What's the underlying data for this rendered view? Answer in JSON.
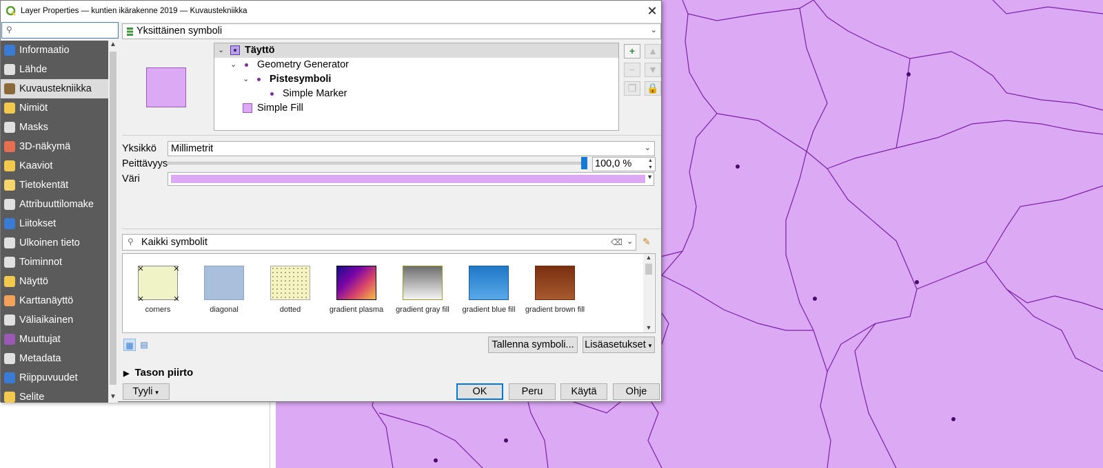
{
  "window": {
    "title": "Layer Properties — kuntien ikärakenne 2019 — Kuvaustekniikka",
    "close_glyph": "✕"
  },
  "sidebar": {
    "search_placeholder": "",
    "items": [
      {
        "label": "Informaatio",
        "icon": "info-icon",
        "color": "#3a7bd5"
      },
      {
        "label": "Lähde",
        "icon": "source-icon",
        "color": "#e0e0e0"
      },
      {
        "label": "Kuvaustekniikka",
        "icon": "paintbrush-icon",
        "color": "#8a6a3a",
        "active": true
      },
      {
        "label": "Nimiöt",
        "icon": "labels-icon",
        "color": "#f2c94c"
      },
      {
        "label": "Masks",
        "icon": "masks-icon",
        "color": "#e0e0e0"
      },
      {
        "label": "3D-näkymä",
        "icon": "cube-icon",
        "color": "#e76f51"
      },
      {
        "label": "Kaaviot",
        "icon": "diagram-icon",
        "color": "#f2c94c"
      },
      {
        "label": "Tietokentät",
        "icon": "fields-icon",
        "color": "#f6d66b"
      },
      {
        "label": "Attribuuttilomake",
        "icon": "form-icon",
        "color": "#e0e0e0"
      },
      {
        "label": "Liitokset",
        "icon": "joins-icon",
        "color": "#3a7bd5"
      },
      {
        "label": "Ulkoinen tieto",
        "icon": "aux-storage-icon",
        "color": "#e0e0e0"
      },
      {
        "label": "Toiminnot",
        "icon": "gear-icon",
        "color": "#e0e0e0"
      },
      {
        "label": "Näyttö",
        "icon": "display-tip-icon",
        "color": "#f2c94c"
      },
      {
        "label": "Karttanäyttö",
        "icon": "map-tips-icon",
        "color": "#f4a259"
      },
      {
        "label": "Väliaikainen",
        "icon": "clock-icon",
        "color": "#e0e0e0"
      },
      {
        "label": "Muuttujat",
        "icon": "variables-icon",
        "color": "#9b59b6"
      },
      {
        "label": "Metadata",
        "icon": "metadata-icon",
        "color": "#e0e0e0"
      },
      {
        "label": "Riippuvuudet",
        "icon": "dependencies-icon",
        "color": "#3a7bd5"
      },
      {
        "label": "Selite",
        "icon": "legend-icon",
        "color": "#f2c94c"
      }
    ]
  },
  "renderer": {
    "value": "Yksittäinen symboli"
  },
  "symbol_tree": [
    {
      "label": "Täyttö",
      "bold": true
    },
    {
      "label": "Geometry Generator",
      "bold": false
    },
    {
      "label": "Pistesymboli",
      "bold": true
    },
    {
      "label": "Simple Marker",
      "bold": false
    },
    {
      "label": "Simple Fill",
      "bold": false
    }
  ],
  "tree_tools": {
    "add": "+",
    "remove": "−",
    "up": "▲",
    "down": "▼",
    "duplicate": "❐",
    "lock": "🔒"
  },
  "props": {
    "unit_label": "Yksikkö",
    "unit_value": "Millimetrit",
    "opacity_label": "Peittävyys",
    "opacity_value": "100,0 %",
    "opacity_fraction": 1.0,
    "color_label": "Väri",
    "fill_color": "#dca9f5"
  },
  "library": {
    "search_value": "Kaikki symbolit",
    "symbols": [
      {
        "name": "corners"
      },
      {
        "name": "diagonal"
      },
      {
        "name": "dotted"
      },
      {
        "name": "gradient plasma"
      },
      {
        "name": "gradient  gray fill"
      },
      {
        "name": "gradient blue fill"
      },
      {
        "name": "gradient brown fill"
      }
    ]
  },
  "buttons": {
    "save_symbol": "Tallenna symboli...",
    "advanced": "Lisäasetukset",
    "style": "Tyyli",
    "ok": "OK",
    "cancel": "Peru",
    "apply": "Käytä",
    "help": "Ohje"
  },
  "section": {
    "layer_rendering": "Tason piirto"
  },
  "map": {
    "fill_color": "#dca9f5",
    "stroke_color": "#7a1fa8"
  }
}
